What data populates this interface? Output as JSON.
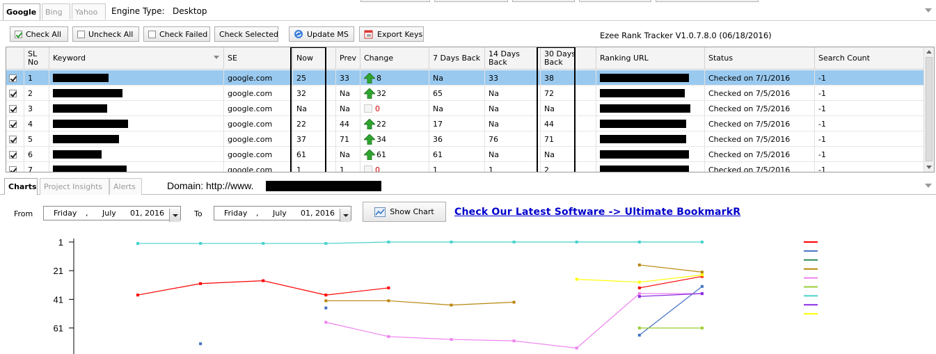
{
  "engine_tabs": [
    {
      "label": "Google",
      "active": true
    },
    {
      "label": "Bing",
      "active": false
    },
    {
      "label": "Yahoo",
      "active": false
    }
  ],
  "engine_type": {
    "label": "Engine Type:",
    "value": "Desktop"
  },
  "toolbar": {
    "check_all": "Check All",
    "uncheck_all": "Uncheck All",
    "check_failed": "Check Failed",
    "check_selected": "Check Selected",
    "update_ms": "Update MS",
    "export_keys": "Export Keys",
    "version": "Ezee Rank Tracker V1.0.7.8.0 (06/18/2016)"
  },
  "grid": {
    "columns": {
      "sl": "SL No",
      "keyword": "Keyword",
      "se": "SE",
      "now": "Now",
      "prev": "Prev",
      "change": "Change",
      "d7": "7 Days Back",
      "d14": "14 Days Back",
      "d30": "30 Days Back",
      "url": "Ranking URL",
      "status": "Status",
      "count": "Search Count"
    },
    "rows": [
      {
        "sl": "1",
        "se": "google.com",
        "now": "25",
        "prev": "33",
        "change": "8",
        "trend": "up",
        "d7": "Na",
        "d14": "33",
        "d30": "38",
        "status": "Checked on 7/1/2016",
        "count": "-1",
        "selected": true
      },
      {
        "sl": "2",
        "se": "google.com",
        "now": "32",
        "prev": "Na",
        "change": "32",
        "trend": "up",
        "d7": "65",
        "d14": "Na",
        "d30": "72",
        "status": "Checked on 7/5/2016",
        "count": "-1",
        "selected": false
      },
      {
        "sl": "3",
        "se": "google.com",
        "now": "Na",
        "prev": "Na",
        "change": "0",
        "trend": "none",
        "d7": "Na",
        "d14": "Na",
        "d30": "Na",
        "status": "Checked on 7/5/2016",
        "count": "-1",
        "selected": false
      },
      {
        "sl": "4",
        "se": "google.com",
        "now": "22",
        "prev": "44",
        "change": "22",
        "trend": "up",
        "d7": "17",
        "d14": "Na",
        "d30": "44",
        "status": "Checked on 7/5/2016",
        "count": "-1",
        "selected": false
      },
      {
        "sl": "5",
        "se": "google.com",
        "now": "37",
        "prev": "71",
        "change": "34",
        "trend": "up",
        "d7": "36",
        "d14": "76",
        "d30": "71",
        "status": "Checked on 7/5/2016",
        "count": "-1",
        "selected": false
      },
      {
        "sl": "6",
        "se": "google.com",
        "now": "61",
        "prev": "Na",
        "change": "61",
        "trend": "up",
        "d7": "61",
        "d14": "Na",
        "d30": "Na",
        "status": "Checked on 7/5/2016",
        "count": "-1",
        "selected": false
      },
      {
        "sl": "7",
        "se": "google.com",
        "now": "1",
        "prev": "1",
        "change": "0",
        "trend": "none",
        "d7": "1",
        "d14": "1",
        "d30": "2",
        "status": "Checked on 7/5/2016",
        "count": "-1",
        "selected": false
      }
    ]
  },
  "lower_tabs": [
    {
      "label": "Charts",
      "active": true
    },
    {
      "label": "Project Insights",
      "active": false
    },
    {
      "label": "Alerts",
      "active": false
    }
  ],
  "domain": {
    "label": "Domain: http://www."
  },
  "date_range": {
    "from_label": "From",
    "from": {
      "day": "Friday",
      "month": "July",
      "date": "01, 2016"
    },
    "to_label": "To",
    "to": {
      "day": "Friday",
      "month": "July",
      "date": "01, 2016"
    },
    "comma": ","
  },
  "show_chart": "Show Chart",
  "promo_link": "Check Our Latest Software -> Ultimate BookmarkR",
  "colors": {
    "selected_row": "#99c9ef",
    "up_arrow": "#2fa52f",
    "link": "#0000cc"
  },
  "chart_data": {
    "type": "line",
    "yticks": [
      "1",
      "21",
      "41",
      "61"
    ],
    "y_inverted": true,
    "ylim": [
      1,
      80
    ],
    "x_points": 10,
    "grid": false,
    "legend_placement": "right",
    "series": [
      {
        "color": "#ff0000",
        "values": [
          38,
          30,
          28,
          38,
          33,
          null,
          null,
          null,
          33,
          25
        ]
      },
      {
        "color": "#4472c4",
        "values": [
          null,
          72,
          null,
          47,
          null,
          null,
          null,
          null,
          66,
          32
        ]
      },
      {
        "color": "#2e8b57",
        "values": [
          null,
          null,
          null,
          null,
          null,
          null,
          null,
          null,
          null,
          null
        ]
      },
      {
        "color": "#b8860b",
        "values": [
          null,
          null,
          null,
          42,
          42,
          45,
          43,
          null,
          17,
          22
        ]
      },
      {
        "color": "#ee82ee",
        "values": [
          null,
          null,
          null,
          57,
          67,
          69,
          70,
          75,
          37,
          37
        ]
      },
      {
        "color": "#9acd32",
        "values": [
          null,
          null,
          null,
          null,
          null,
          null,
          null,
          null,
          61,
          61
        ]
      },
      {
        "color": "#48d1cc",
        "values": [
          2,
          2,
          2,
          2,
          1,
          1,
          1,
          1,
          1,
          1
        ]
      },
      {
        "color": "#8a2be2",
        "values": [
          null,
          null,
          null,
          null,
          null,
          null,
          null,
          null,
          39,
          37
        ]
      },
      {
        "color": "#ffff00",
        "values": [
          null,
          null,
          null,
          null,
          null,
          null,
          null,
          27,
          29,
          24
        ]
      }
    ]
  }
}
